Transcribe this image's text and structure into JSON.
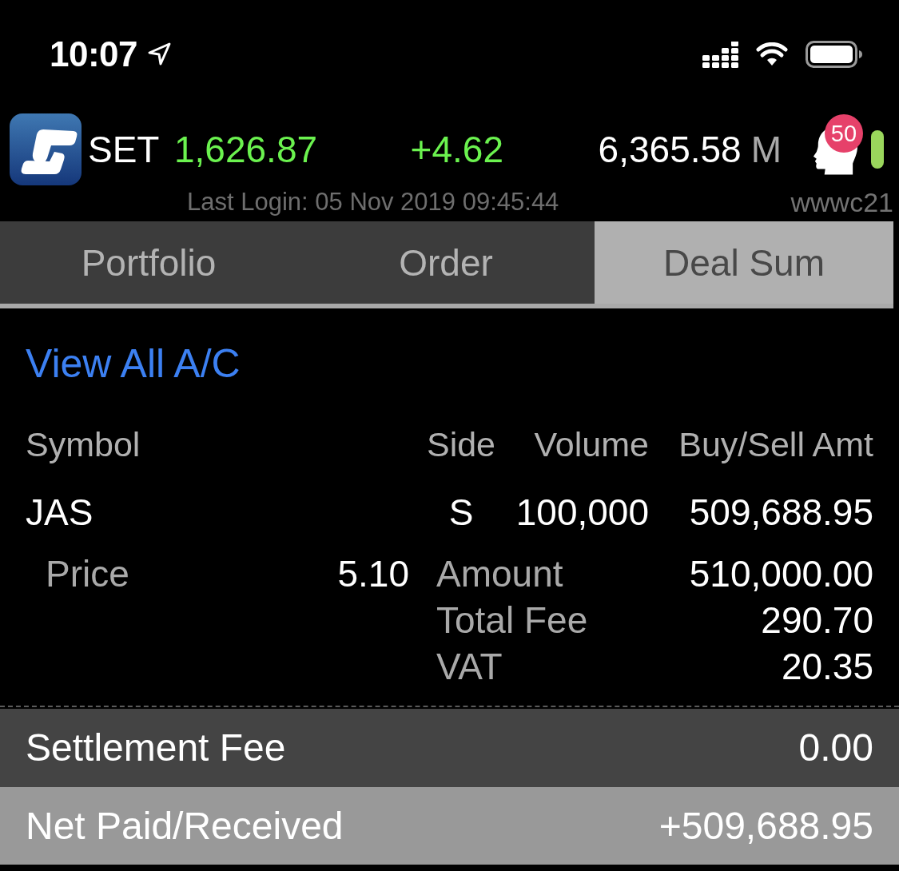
{
  "status_bar": {
    "time": "10:07"
  },
  "market": {
    "index_name": "SET",
    "index_value": "1,626.87",
    "change": "+4.62",
    "turnover": "6,365.58",
    "turnover_unit": "M",
    "alert_count": "50",
    "last_login": "Last Login: 05 Nov 2019 09:45:44",
    "user_id": "wwwc21"
  },
  "tabs": [
    {
      "label": "Portfolio",
      "selected": false
    },
    {
      "label": "Order",
      "selected": false
    },
    {
      "label": "Deal Sum",
      "selected": true
    }
  ],
  "view_all_link": "View All A/C",
  "table": {
    "columns": [
      "Symbol",
      "Side",
      "Volume",
      "Buy/Sell Amt"
    ],
    "rows": [
      {
        "symbol": "JAS",
        "side": "S",
        "volume": "100,000",
        "amount": "509,688.95",
        "price_label": "Price",
        "price": "5.10",
        "charges": [
          {
            "label": "Amount",
            "value": "510,000.00"
          },
          {
            "label": "Total Fee",
            "value": "290.70"
          },
          {
            "label": "VAT",
            "value": "20.35"
          }
        ]
      }
    ]
  },
  "summary": [
    {
      "kind": "subtotal",
      "label": "Settlement Fee",
      "value": "0.00"
    },
    {
      "kind": "total",
      "label": "Net Paid/Received",
      "value": "+509,688.95"
    }
  ]
}
